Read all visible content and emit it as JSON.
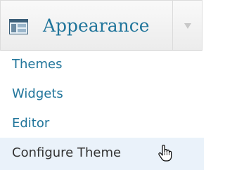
{
  "menu": {
    "title": "Appearance",
    "icon": "appearance-window-icon",
    "toggle_icon": "dropdown-arrow-icon",
    "colors": {
      "link": "#21759b",
      "hover_text": "#333333",
      "hover_background": "#eaf2fa",
      "header_background": "#f1f1f1"
    },
    "items": [
      {
        "label": "Themes"
      },
      {
        "label": "Widgets"
      },
      {
        "label": "Editor"
      },
      {
        "label": "Configure Theme",
        "state": "hover"
      }
    ]
  },
  "cursor": {
    "icon": "hand-pointer-icon"
  }
}
